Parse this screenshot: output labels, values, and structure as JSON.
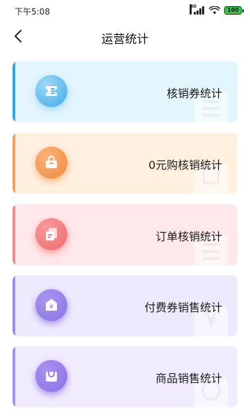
{
  "status_bar": {
    "time": "下午5:08",
    "signal_tag": "HD",
    "battery_level": "100"
  },
  "header": {
    "title": "运营统计",
    "back_icon": "chevron-left-icon"
  },
  "cards": [
    {
      "label": "核销券统计",
      "icon": "ticket-icon",
      "accent": "#2ea8e0",
      "bg": "#e3f5fd",
      "icon_bg": "#9fdaf7",
      "icon_color": "#3fa9e8"
    },
    {
      "label": "0元购核销统计",
      "icon": "shopping-bag-icon",
      "accent": "#f5a15d",
      "bg": "#fff0e0",
      "icon_bg": "#fbb27a",
      "icon_color": "#f08a3e"
    },
    {
      "label": "订单核销统计",
      "icon": "order-icon",
      "accent": "#f08a8e",
      "bg": "#ffe8e9",
      "icon_bg": "#f79a9c",
      "icon_color": "#ef6a6e"
    },
    {
      "label": "付费券销售统计",
      "icon": "paid-coupon-icon",
      "accent": "#9f8ce6",
      "bg": "#eeeafe",
      "icon_bg": "#a894ee",
      "icon_color": "#8a74e2"
    },
    {
      "label": "商品销售统计",
      "icon": "product-icon",
      "accent": "#a790f0",
      "bg": "#f0ecfe",
      "icon_bg": "#a98ff0",
      "icon_color": "#8b72e6"
    }
  ]
}
